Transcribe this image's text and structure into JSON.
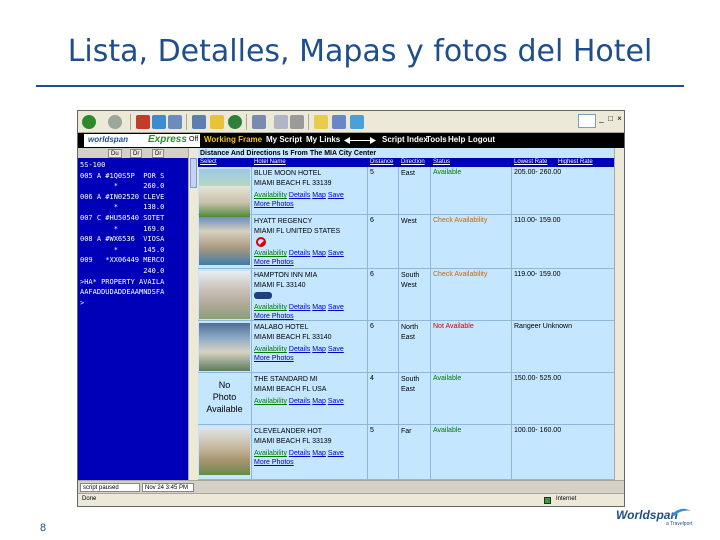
{
  "slide": {
    "title": "Lista, Detalles, Mapas y fotos del Hotel",
    "number": "8"
  },
  "logo": {
    "brand": "Worldspan",
    "sub": "a Travelport"
  },
  "app": {
    "brand_left": "worldspan",
    "brand_express": "Express",
    "brand_off": "Off",
    "menu": [
      "Working Frame",
      "My Script",
      "My Links",
      "Script Index",
      "Tools",
      "Help",
      "Logout"
    ]
  },
  "terminal": {
    "tabs": [
      "Du",
      "Dr",
      "Dr"
    ],
    "lines": [
      "5S-100",
      "005 A #1Q0S5P  POR S",
      "        *      260.0",
      "006 A #IN02520 CLEVE",
      "        *      138.0",
      "007 C #HU50540 SOTET",
      "        *      169.0",
      "008 A #WX6536  VIOSA",
      "        *      145.0",
      "009   *XX06449 MERCO",
      "               240.0",
      ">HA* PROPERTY AVAILA",
      "AAFADDUDADDEAAMNDSFA",
      ">"
    ],
    "cmd": [
      "script paused",
      "Nov 24  3:45 PM"
    ]
  },
  "hotel_list": {
    "heading": "Distance And Directions Is From The MIA City Center",
    "columns": [
      "Select",
      "Hotel Name",
      "Distance",
      "Direction",
      "Status",
      "Lowest Rate",
      "Highest Rate"
    ],
    "rows": [
      {
        "name": "BLUE MOON HOTEL\nMIAMI BEACH FL 33139",
        "links": [
          "Availability",
          "Details",
          "Map",
          "Save"
        ],
        "more": "More Photos",
        "distance": "5",
        "direction": "East",
        "status": "Available",
        "status_color": "#007a00",
        "rate": "205.00-  260.00"
      },
      {
        "name": "HYATT REGENCY\nMIAMI FL UNITED STATES",
        "links": [
          "Availability",
          "Details",
          "Map",
          "Save"
        ],
        "more": "More Photos",
        "distance": "6",
        "direction": "West",
        "status": "Check Availability",
        "status_color": "#cc6600",
        "rate": "110.00-  159.00"
      },
      {
        "name": "HAMPTON INN MIA\nMIAMI FL 33140",
        "links": [
          "Availability",
          "Details",
          "Map",
          "Save"
        ],
        "more": "More Photos",
        "distance": "6",
        "direction": "South\nWest",
        "status": "Check Availability",
        "status_color": "#cc6600",
        "rate": "119.00-  159.00"
      },
      {
        "name": "MALABO HOTEL\nMIAMI BEACH FL 33140",
        "links": [
          "Availability",
          "Details",
          "Map",
          "Save"
        ],
        "more": "More Photos",
        "distance": "6",
        "direction": "North\nEast",
        "status": "Not Available",
        "status_color": "#cc0000",
        "rate": "Rangeer Unknown"
      },
      {
        "name": "THE STANDARD MI\nMIAMI BEACH FL USA",
        "nophoto": "No\nPhoto\nAvailable",
        "links": [
          "Availability",
          "Details",
          "Map",
          "Save"
        ],
        "more": "",
        "distance": "4",
        "direction": "South\nEast",
        "status": "Available",
        "status_color": "#007a00",
        "rate": "150.00-  525.00"
      },
      {
        "name": "CLEVELANDER HOT\nMIAMI BEACH FL 33139",
        "links": [
          "Availability",
          "Details",
          "Map",
          "Save"
        ],
        "more": "More Photos",
        "distance": "5",
        "direction": "Far",
        "status": "Available",
        "status_color": "#007a00",
        "rate": "100.00-  160.00"
      }
    ]
  },
  "statusbar": {
    "left": "Done",
    "right": "Internet"
  }
}
